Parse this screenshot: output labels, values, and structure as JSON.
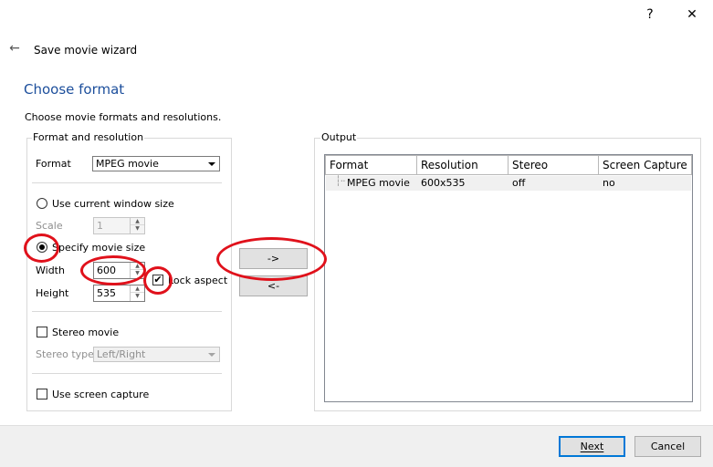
{
  "window": {
    "help_glyph": "?",
    "close_glyph": "✕",
    "back_glyph": "←",
    "title": "Save movie wizard"
  },
  "page": {
    "heading": "Choose format",
    "subheading": "Choose movie formats and resolutions."
  },
  "format_group": {
    "legend": "Format and resolution",
    "format_label": "Format",
    "format_value": "MPEG movie",
    "use_current_label": "Use current window size",
    "scale_label": "Scale",
    "scale_value": "1",
    "specify_label": "Specify movie size",
    "width_label": "Width",
    "width_value": "600",
    "height_label": "Height",
    "height_value": "535",
    "lock_aspect_label": "Lock aspect",
    "lock_aspect_checked": true,
    "stereo_label": "Stereo movie",
    "stereo_type_label": "Stereo type",
    "stereo_type_value": "Left/Right",
    "screen_capture_label": "Use screen capture",
    "selected_size_mode": "specify"
  },
  "transfer": {
    "add_label": "->",
    "remove_label": "<-"
  },
  "output_group": {
    "legend": "Output",
    "columns": [
      "Format",
      "Resolution",
      "Stereo",
      "Screen Capture"
    ],
    "rows": [
      {
        "format": "MPEG movie",
        "resolution": "600x535",
        "stereo": "off",
        "screen_capture": "no"
      }
    ]
  },
  "footer": {
    "next_label": "Next",
    "cancel_label": "Cancel"
  },
  "annotation_color": "#e0111b",
  "accent_color": "#1d4f9c"
}
